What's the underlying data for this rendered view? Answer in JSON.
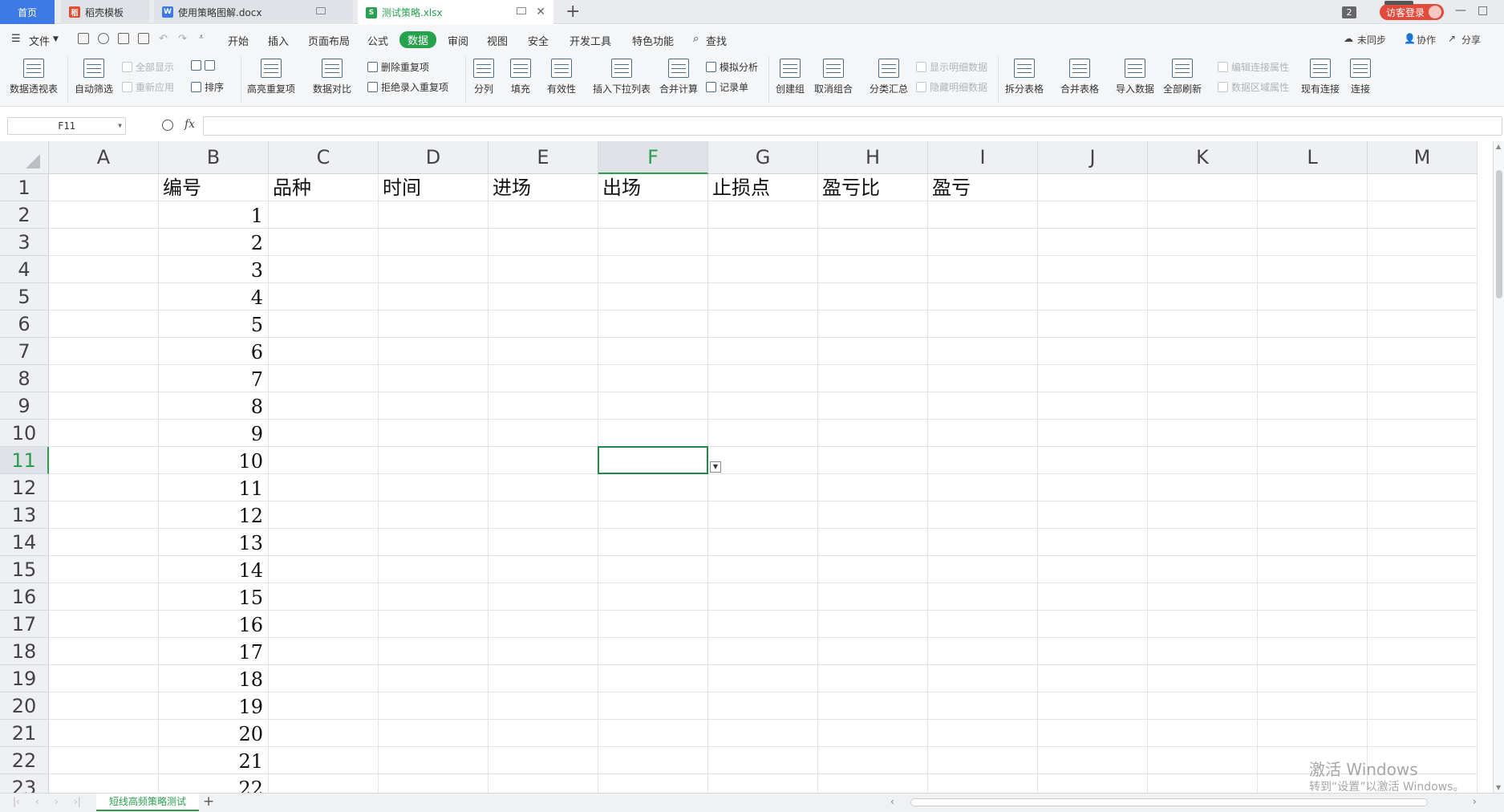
{
  "tabs": {
    "home": "首页",
    "tab1": "稻壳模板",
    "tab2": "使用策略图解.docx",
    "tab3": "测试策略.xlsx",
    "new_tab": "+",
    "window_count": "2",
    "login": "访客登录"
  },
  "menu": {
    "file": "文件",
    "items": [
      "开始",
      "插入",
      "页面布局",
      "公式",
      "数据",
      "审阅",
      "视图",
      "安全",
      "开发工具",
      "特色功能"
    ],
    "active": "数据",
    "search": "查找",
    "sync": "未同步",
    "collab": "协作",
    "share": "分享"
  },
  "ribbon": {
    "pivot": "数据透视表",
    "autofilter": "自动筛选",
    "show_all": "全部显示",
    "reapply": "重新应用",
    "sort": "排序",
    "highlight_dup": "高亮重复项",
    "compare": "数据对比",
    "remove_dup": "删除重复项",
    "reject_dup": "拒绝录入重复项",
    "split": "分列",
    "fill": "填充",
    "validity": "有效性",
    "insert_dropdown": "插入下拉列表",
    "consolidate": "合并计算",
    "whatif": "模拟分析",
    "record_form": "记录单",
    "create_group": "创建组",
    "ungroup": "取消组合",
    "subtotal": "分类汇总",
    "show_detail": "显示明细数据",
    "hide_detail": "隐藏明细数据",
    "split_table": "拆分表格",
    "merge_table": "合并表格",
    "import_data": "导入数据",
    "refresh_all": "全部刷新",
    "edit_links": "编辑连接属性",
    "range_props": "数据区域属性",
    "existing_conn": "现有连接",
    "connect": "连接"
  },
  "formula_bar": {
    "name_box": "F11",
    "fx": "fx",
    "value": ""
  },
  "sheet": {
    "columns": [
      "A",
      "B",
      "C",
      "D",
      "E",
      "F",
      "G",
      "H",
      "I",
      "J",
      "K",
      "L",
      "M"
    ],
    "rows": [
      "1",
      "2",
      "3",
      "4",
      "5",
      "6",
      "7",
      "8",
      "9",
      "10",
      "11",
      "12",
      "13",
      "14",
      "15",
      "16",
      "17",
      "18",
      "19",
      "20",
      "21",
      "22",
      "23"
    ],
    "headers": [
      "编号",
      "品种",
      "时间",
      "进场",
      "出场",
      "止损点",
      "盈亏比",
      "盈亏"
    ],
    "ids": [
      "1",
      "2",
      "3",
      "4",
      "5",
      "6",
      "7",
      "8",
      "9",
      "10",
      "11",
      "12",
      "13",
      "14",
      "15",
      "16",
      "17",
      "18",
      "19",
      "20",
      "21",
      "22"
    ],
    "selected_cell": "F11",
    "sheet_tab": "短线高频策略测试",
    "add_sheet": "+"
  },
  "watermark": {
    "line1": "激活 Windows",
    "line2": "转到“设置”以激活 Windows。"
  },
  "colors": {
    "accent": "#26a24d",
    "home_tab": "#3e7ae6",
    "login": "#e24b3c"
  }
}
